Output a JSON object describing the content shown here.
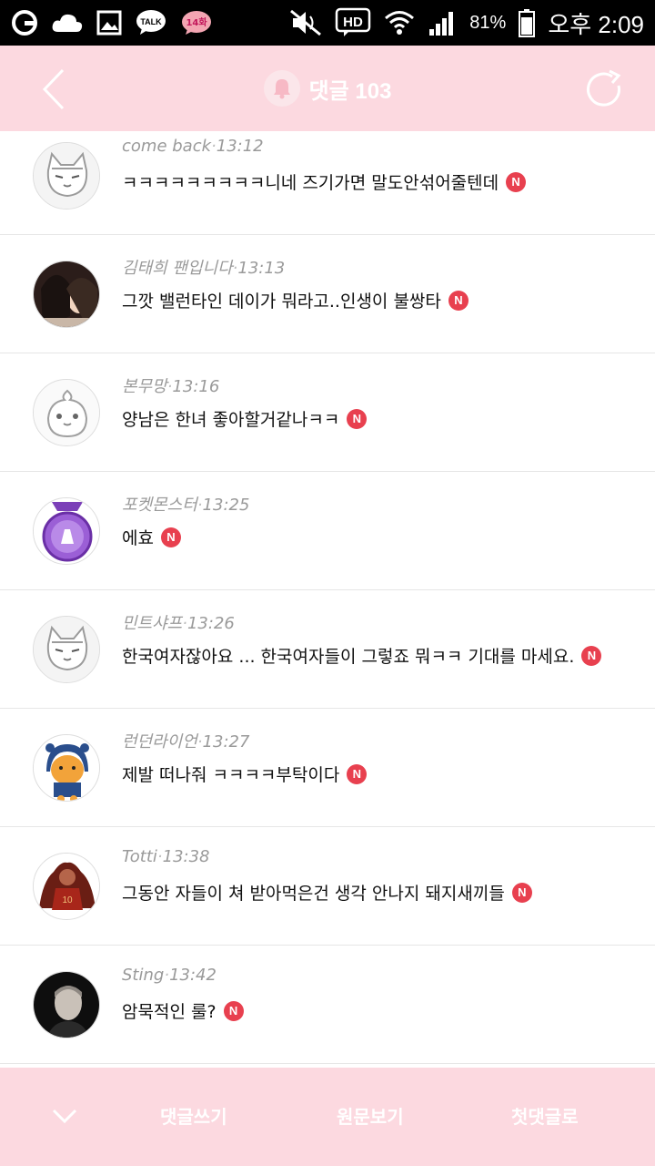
{
  "status_bar": {
    "talk_label": "TALK",
    "notif_label": "14화",
    "hd_label": "HD",
    "battery": "81%",
    "time": "오후 2:09"
  },
  "header": {
    "title": "댓글 103"
  },
  "comments": [
    {
      "author": "come back",
      "time": "13:12",
      "text": "ㅋㅋㅋㅋㅋㅋㅋㅋㅋ니네 즈기가면 말도안섞어줄텐데",
      "badge": "N"
    },
    {
      "author": "김태희 팬입니다",
      "time": "13:13",
      "text": "그깟 밸런타인 데이가 뭐라고..인생이 불쌍타",
      "badge": "N"
    },
    {
      "author": "본무망",
      "time": "13:16",
      "text": "양남은 한녀 좋아할거같나ㅋㅋ",
      "badge": "N"
    },
    {
      "author": "포켓몬스터",
      "time": "13:25",
      "text": "에효",
      "badge": "N"
    },
    {
      "author": "민트샤프",
      "time": "13:26",
      "text": "한국여자잖아요 ... 한국여자들이 그렇죠 뭐ㅋㅋ 기대를 마세요.",
      "badge": "N"
    },
    {
      "author": "런던라이언",
      "time": "13:27",
      "text": "제발 떠나줘 ㅋㅋㅋㅋ부탁이다",
      "badge": "N"
    },
    {
      "author": "Totti",
      "time": "13:38",
      "text": "그동안 자들이 쳐 받아먹은건 생각 안나지 돼지새끼들",
      "badge": "N"
    },
    {
      "author": "Sting",
      "time": "13:42",
      "text": "암묵적인 룰?",
      "badge": "N"
    }
  ],
  "bottom_bar": {
    "write_label": "댓글쓰기",
    "original_label": "원문보기",
    "first_label": "첫댓글로"
  },
  "colors": {
    "header_bg": "#fcd9e0",
    "badge": "#e8404f"
  }
}
